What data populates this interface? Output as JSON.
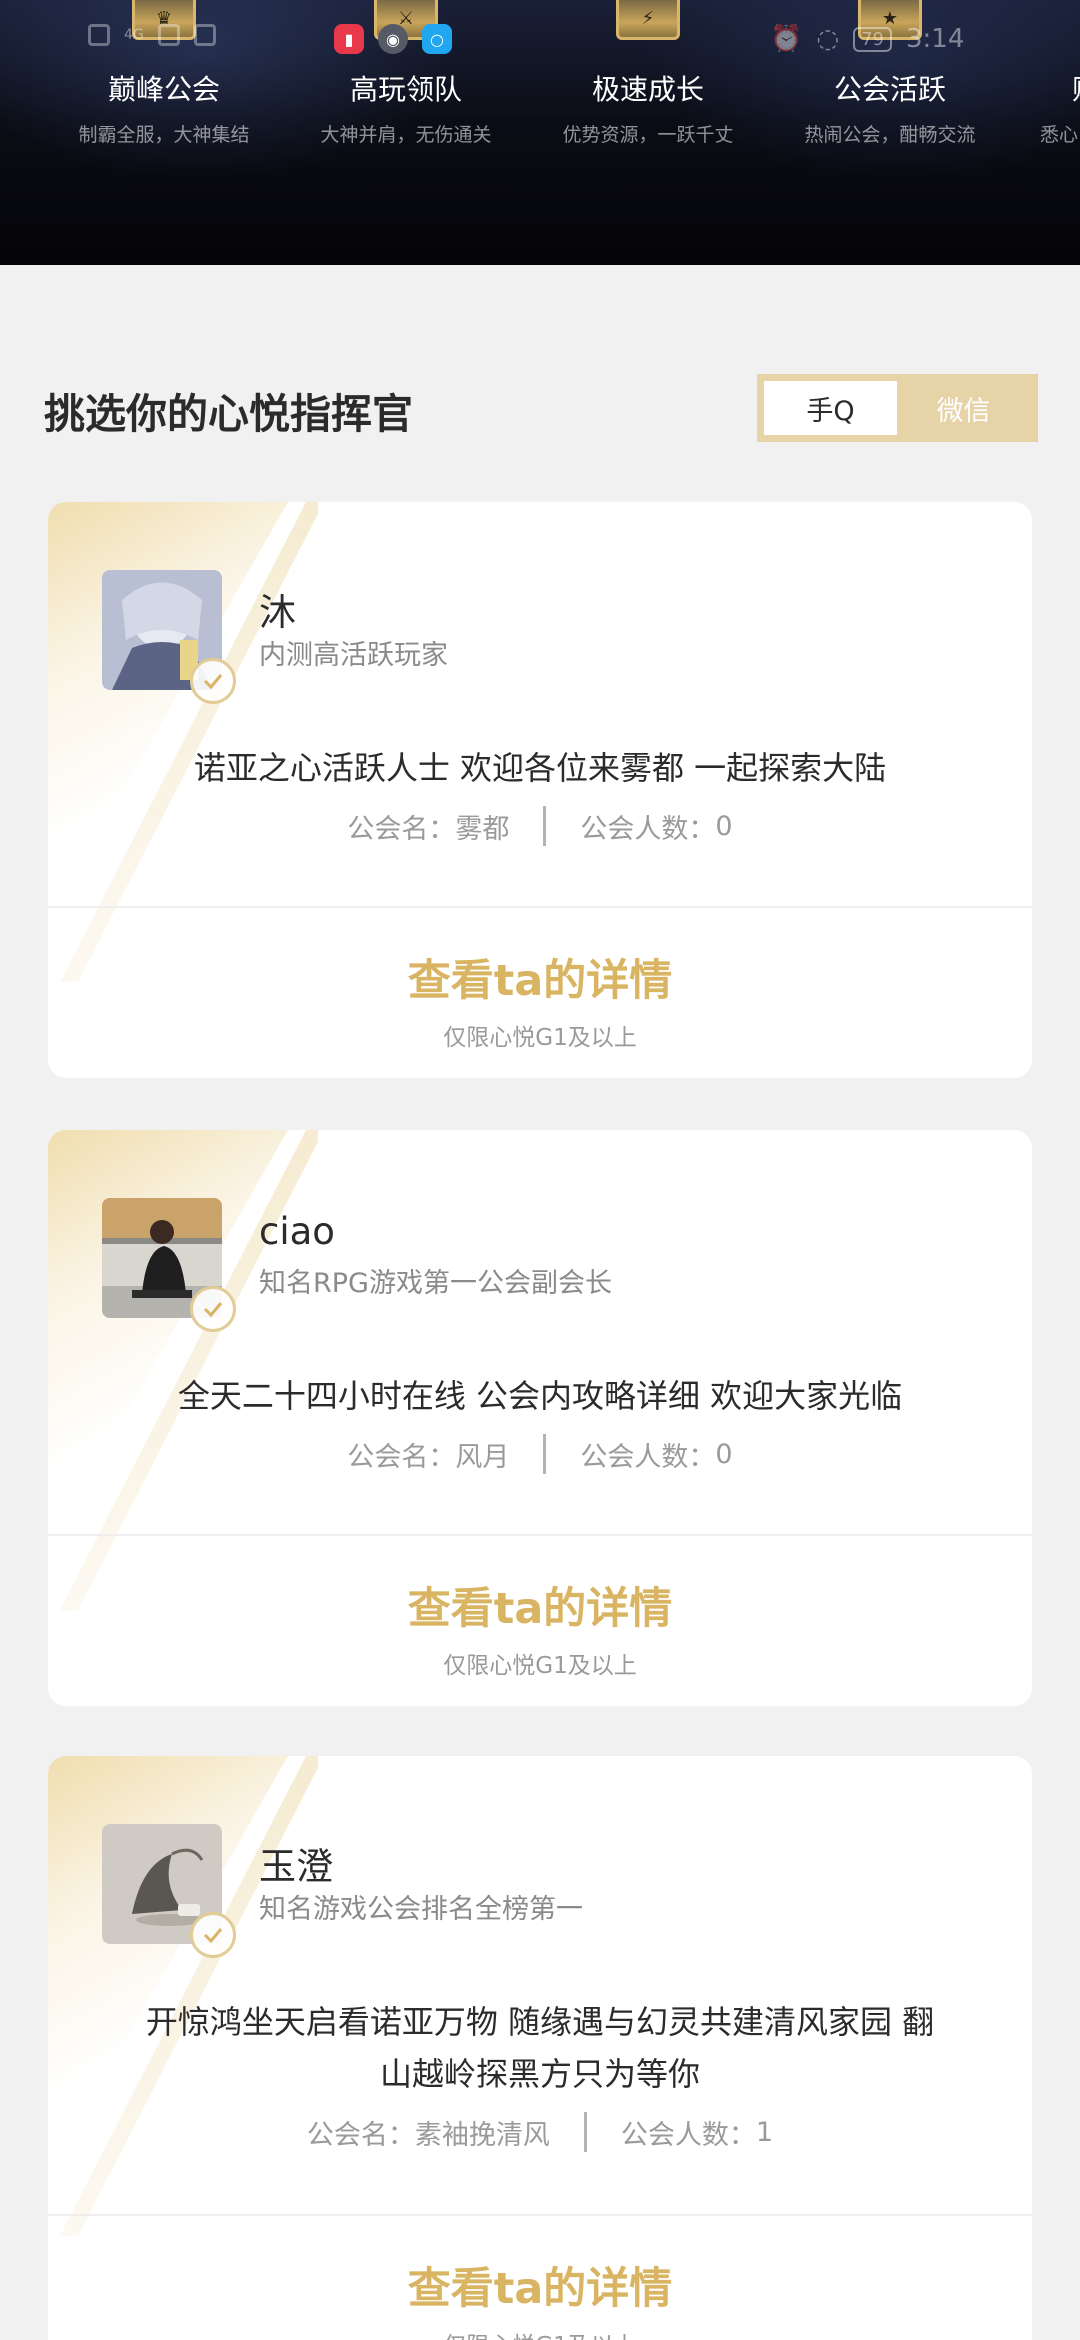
{
  "status_bar": {
    "network": "4G",
    "time": "3:14",
    "battery": "79",
    "app_icons": [
      "book-app-icon",
      "media-app-icon",
      "search-app-icon"
    ]
  },
  "features": [
    {
      "title": "巅峰公会",
      "subtitle": "制霸全服，大神集结"
    },
    {
      "title": "高玩领队",
      "subtitle": "大神并肩，无伤通关"
    },
    {
      "title": "极速成长",
      "subtitle": "优势资源，一跃千丈"
    },
    {
      "title": "公会活跃",
      "subtitle": "热闹公会，酣畅交流"
    },
    {
      "title": "贴",
      "subtitle": "悉心"
    }
  ],
  "section": {
    "title": "挑选你的心悦指挥官",
    "toggle": {
      "option_a": "手Q",
      "option_b": "微信",
      "selected": "手Q"
    }
  },
  "labels": {
    "guild_name_label": "公会名：",
    "guild_members_label": "公会人数：",
    "detail_button": "查看ta的详情",
    "detail_note": "仅限心悦G1及以上"
  },
  "commanders": [
    {
      "name": "沐",
      "title": "内测高活跃玩家",
      "slogan": "诺亚之心活跃人士 欢迎各位来雾都 一起探索大陆",
      "guild_name": "雾都",
      "guild_members": "0"
    },
    {
      "name": "ciao",
      "title": "知名RPG游戏第一公会副会长",
      "slogan": "全天二十四小时在线 公会内攻略详细 欢迎大家光临",
      "guild_name": "风月",
      "guild_members": "0"
    },
    {
      "name": "玉澄",
      "title": "知名游戏公会排名全榜第一",
      "slogan": "开惊鸿坐天启看诺亚万物 随缘遇与幻灵共建清风家园 翻山越岭探黑方只为等你",
      "guild_name": "素袖挽清风",
      "guild_members": "1"
    }
  ],
  "colors": {
    "accent_gold": "#d9b462",
    "toggle_bg": "#e6d3a8",
    "page_bg": "#f1f1f1",
    "banner_dark": "#0b0d16"
  }
}
